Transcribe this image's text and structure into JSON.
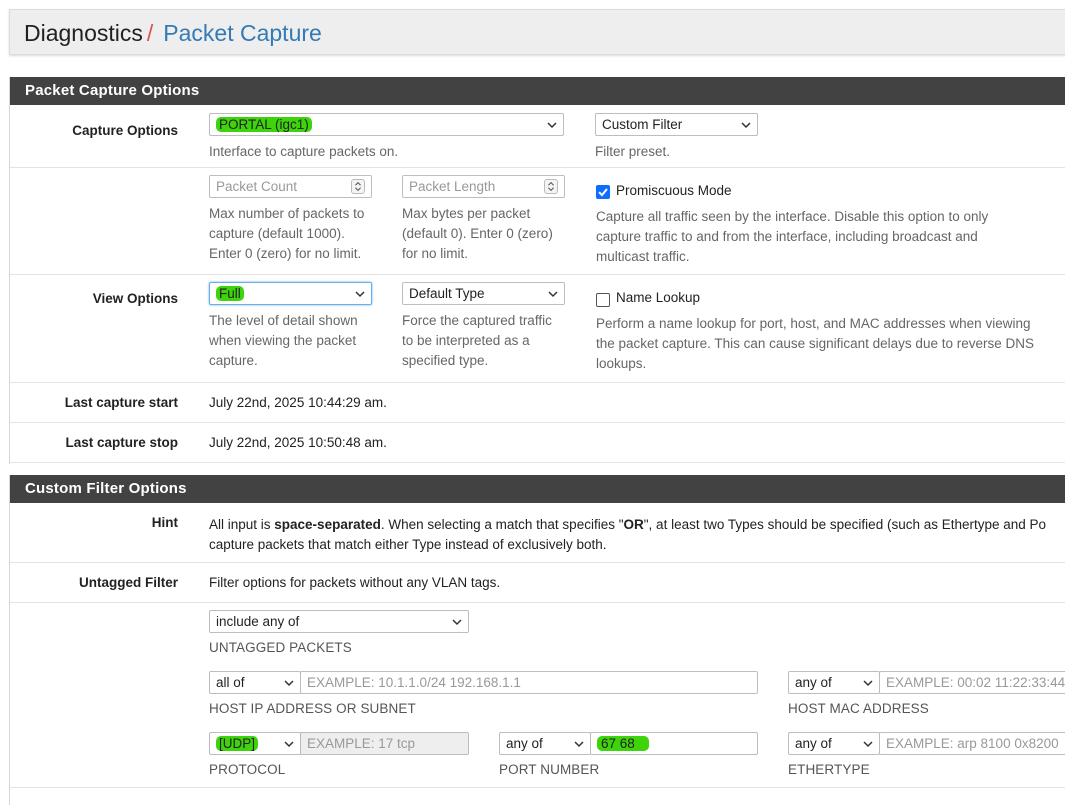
{
  "breadcrumb": {
    "root": "Diagnostics",
    "separator": "/",
    "current": "Packet Capture"
  },
  "capture_panel": {
    "title": "Packet Capture Options",
    "capture_options": {
      "label": "Capture Options",
      "interface_value": "PORTAL (igc1)",
      "interface_help": "Interface to capture packets on.",
      "filter_value": "Custom Filter",
      "filter_help": "Filter preset."
    },
    "counts": {
      "packet_count_placeholder": "Packet Count",
      "packet_count_help": [
        "Max number of packets to",
        "capture (default 1000).",
        "Enter 0 (zero) for no limit."
      ],
      "packet_length_placeholder": "Packet Length",
      "packet_length_help": [
        "Max bytes per packet",
        "(default 0). Enter 0 (zero)",
        "for no limit."
      ],
      "promiscuous_label": "Promiscuous Mode",
      "promiscuous_checked": true,
      "promiscuous_help": [
        "Capture all traffic seen by the interface. Disable this option to only",
        "capture traffic to and from the interface, including broadcast and",
        "multicast traffic."
      ]
    },
    "view_options": {
      "label": "View Options",
      "detail_value": "Full",
      "detail_help": [
        "The level of detail shown",
        "when viewing the packet",
        "capture."
      ],
      "type_value": "Default Type",
      "type_help": [
        "Force the captured traffic",
        "to be interpreted as a",
        "specified type."
      ],
      "name_lookup_label": "Name Lookup",
      "name_lookup_checked": false,
      "name_lookup_help": [
        "Perform a name lookup for port, host, and MAC addresses when viewing",
        "the packet capture. This can cause significant delays due to reverse DNS",
        "lookups."
      ]
    },
    "last_start": {
      "label": "Last capture start",
      "value": "July 22nd, 2025 10:44:29 am."
    },
    "last_stop": {
      "label": "Last capture stop",
      "value": "July 22nd, 2025 10:50:48 am."
    }
  },
  "filter_panel": {
    "title": "Custom Filter Options",
    "hint": {
      "label": "Hint",
      "line1_a": "All input is ",
      "line1_bold": "space-separated",
      "line1_b": ". When selecting a match that specifies \"",
      "line1_or": "OR",
      "line1_c": "\", at least two Types should be specified (such as Ethertype and Po",
      "line2": "capture packets that match either Type instead of exclusively both."
    },
    "untagged": {
      "label": "Untagged Filter",
      "help": "Filter options for packets without any VLAN tags."
    },
    "include_value": "include any of",
    "untagged_packets_label": "UNTAGGED PACKETS",
    "host_ip": {
      "match": "all of",
      "placeholder": "EXAMPLE: 10.1.1.0/24 192.168.1.1",
      "label": "HOST IP ADDRESS OR SUBNET"
    },
    "host_mac": {
      "match": "any of",
      "placeholder": "EXAMPLE: 00:02 11:22:33:44",
      "label": "HOST MAC ADDRESS"
    },
    "protocol": {
      "match": "[UDP]",
      "placeholder": "EXAMPLE: 17 tcp",
      "label": "PROTOCOL"
    },
    "port": {
      "match": "any of",
      "value": "67 68",
      "label": "PORT NUMBER"
    },
    "ethertype": {
      "match": "any of",
      "placeholder": "EXAMPLE: arp 8100 0x8200",
      "label": "ETHERTYPE"
    }
  },
  "colors": {
    "highlight": "#3ed40c",
    "heading_bg": "#424242",
    "link": "#337ab7",
    "separator": "#d9534f",
    "checkbox": "#0d6efd"
  }
}
